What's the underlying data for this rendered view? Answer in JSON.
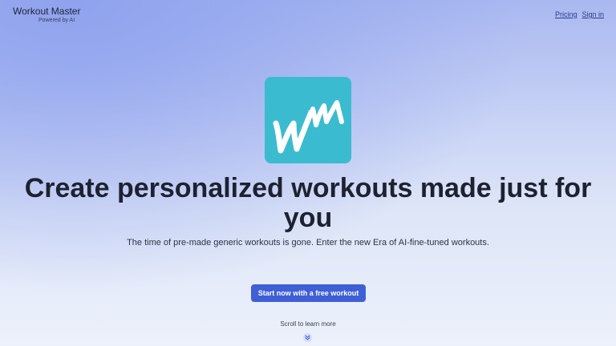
{
  "brand": {
    "title": "Workout Master",
    "subtitle": "Powered by AI"
  },
  "nav": {
    "pricing": "Pricing",
    "sign_in": "Sign in"
  },
  "hero": {
    "logo_icon": "wm-logo-icon",
    "headline": "Create personalized workouts made just for you",
    "subline": "The time of pre-made generic workouts is gone. Enter the new Era of AI-fine-tuned workouts.",
    "cta_label": "Start now with a free workout",
    "scroll_hint": "Scroll to learn more",
    "scroll_icon": "chevron-double-down-icon"
  },
  "colors": {
    "accent": "#3f5fd6",
    "logo_bg": "#3bbbd0"
  }
}
